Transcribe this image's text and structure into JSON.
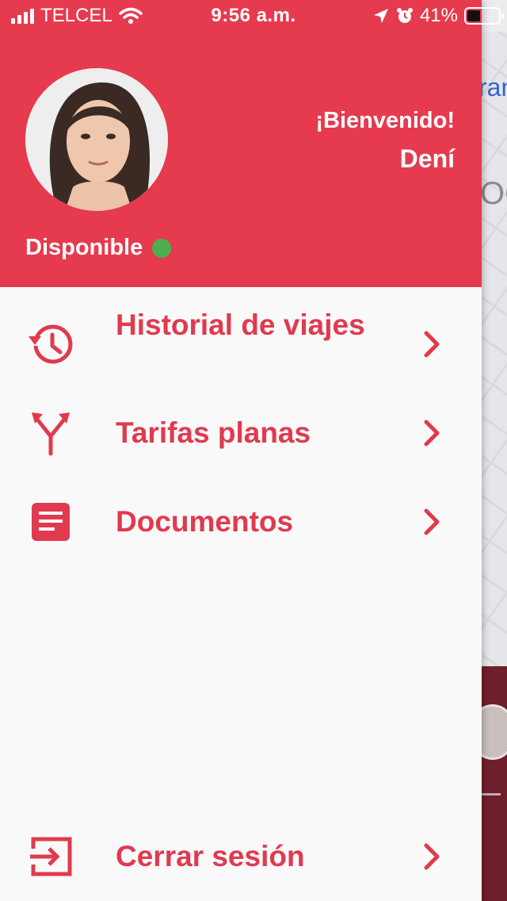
{
  "status_bar": {
    "carrier": "TELCEL",
    "time": "9:56 a.m.",
    "battery": "41%",
    "battery_level": 0.41
  },
  "profile": {
    "welcome": "¡Bienvenido!",
    "name": "Dení",
    "availability": "Disponible",
    "availability_color": "#4caf50"
  },
  "menu": {
    "items": [
      {
        "label": "Historial de viajes",
        "icon": "history-icon"
      },
      {
        "label": "Tarifas planas",
        "icon": "split-arrows-icon"
      },
      {
        "label": "Documentos",
        "icon": "document-icon"
      }
    ],
    "logout": {
      "label": "Cerrar sesión",
      "icon": "logout-icon"
    }
  },
  "background": {
    "link_fragment": "ran",
    "text_fragment": "OC"
  },
  "colors": {
    "accent": "#e63a4e",
    "drawer_bg": "#f9f9f9"
  }
}
